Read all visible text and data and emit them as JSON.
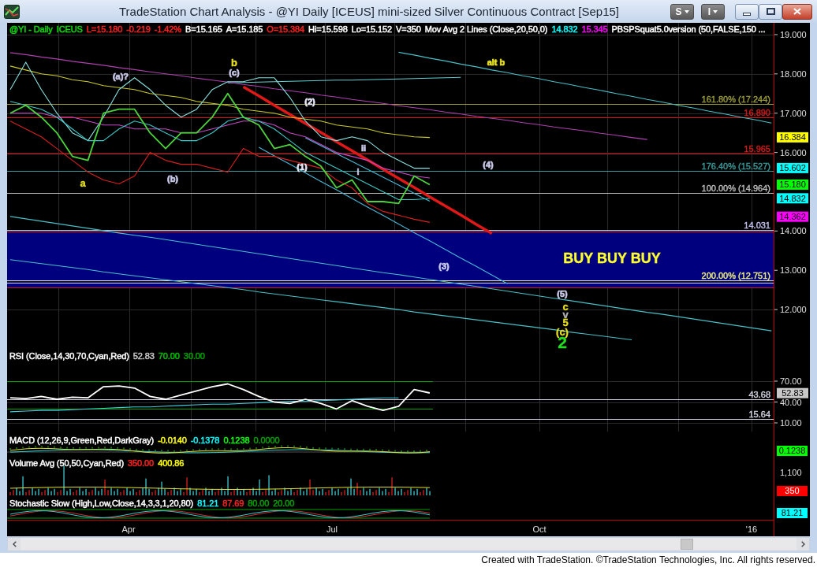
{
  "window": {
    "title": "TradeStation Chart Analysis - @YI Daily [ICEUS] mini-sized Silver Continuous Contract [Sep15]",
    "buttons": [
      {
        "label": "S"
      },
      {
        "label": "I"
      }
    ]
  },
  "price_panel": {
    "legend": [
      {
        "text": "@YI - Daily",
        "color": "#00e000"
      },
      {
        "text": "ICEUS",
        "color": "#00e000"
      },
      {
        "text": "L=15.180",
        "color": "#ff2020"
      },
      {
        "text": "-0.219",
        "color": "#ff2020"
      },
      {
        "text": "-1.42%",
        "color": "#ff2020"
      },
      {
        "text": "B=15.165",
        "color": "#ffffff"
      },
      {
        "text": "A=15.185",
        "color": "#ffffff"
      },
      {
        "text": "O=15.384",
        "color": "#ff2020"
      },
      {
        "text": "Hi=15.598",
        "color": "#ffffff"
      },
      {
        "text": "Lo=15.152",
        "color": "#ffffff"
      },
      {
        "text": "V=350",
        "color": "#ffffff"
      },
      {
        "text": "Mov Avg 2 Lines (Close,20,50,0)",
        "color": "#ffffff"
      },
      {
        "text": "14.832",
        "color": "#00ffff"
      },
      {
        "text": "15.345",
        "color": "#ff00ff"
      },
      {
        "text": "PBSPSquat5.0version (50,FALSE,150 ...",
        "color": "#ffffff"
      }
    ],
    "labels": [
      {
        "text": "b",
        "kind": "wave",
        "color": "#e8e020"
      },
      {
        "text": "(c)",
        "kind": "sub",
        "color": "#c8c8e8"
      },
      {
        "text": "(a)?",
        "kind": "sub",
        "color": "#c8c8e8"
      },
      {
        "text": "a",
        "kind": "wave",
        "color": "#e8e020"
      },
      {
        "text": "(b)",
        "kind": "sub",
        "color": "#c8c8e8"
      },
      {
        "text": "(2)",
        "kind": "sub",
        "color": "#e8e8f8"
      },
      {
        "text": "(1)",
        "kind": "sub",
        "color": "#e8e8f8"
      },
      {
        "text": "ii",
        "kind": "sub",
        "color": "#c8c8e8"
      },
      {
        "text": "i",
        "kind": "sub",
        "color": "#c8c8e8"
      },
      {
        "text": "(4)",
        "kind": "sub",
        "color": "#c8c8e8"
      },
      {
        "text": "alt b",
        "kind": "sub",
        "color": "#e8e020"
      },
      {
        "text": "(3)",
        "kind": "sub",
        "color": "#c8c8e8"
      },
      {
        "text": "BUY BUY BUY",
        "kind": "callout",
        "color": "#ffff30"
      },
      {
        "text": "(5)",
        "kind": "sub",
        "color": "#c8c8e8"
      },
      {
        "text": "c",
        "kind": "wave",
        "color": "#e8e020"
      },
      {
        "text": "v",
        "kind": "wave",
        "color": "#b4b4b4"
      },
      {
        "text": "5",
        "kind": "wave",
        "color": "#e8e020"
      },
      {
        "text": "(c)",
        "kind": "wave",
        "color": "#e8e020"
      },
      {
        "text": "2",
        "kind": "major",
        "color": "#22dd22"
      }
    ],
    "price_tags": [
      {
        "label": "16.384",
        "color": "#ffff00"
      },
      {
        "label": "15.602",
        "color": "#00ffff"
      },
      {
        "label": "15.180",
        "color": "#00ff00"
      },
      {
        "label": "14.832",
        "color": "#00ffff"
      },
      {
        "label": "14.362",
        "color": "#ff00ff"
      }
    ],
    "chart_data": {
      "type": "line",
      "grid": true,
      "categories": [
        null,
        null,
        null,
        null,
        null,
        null,
        null,
        null,
        null,
        null,
        null,
        null,
        null,
        null,
        null,
        null,
        null,
        null,
        null,
        null,
        null,
        null,
        null,
        null,
        null,
        null,
        null,
        null,
        null,
        null,
        null,
        null,
        null,
        null,
        null,
        null,
        null,
        null,
        null,
        null,
        null,
        null,
        null,
        null,
        null,
        null,
        null,
        null,
        null,
        null
      ],
      "series": [
        {
          "color": "#4cd43c",
          "values": [
            17.0,
            17.2,
            16.9,
            16.5,
            15.9,
            15.8,
            17.0,
            17.1,
            17.1,
            16.5,
            16.1,
            16.5,
            16.5,
            16.9,
            17.5,
            16.9,
            16.7,
            16.1,
            16.2,
            15.9,
            15.65,
            15.1,
            15.3,
            14.75,
            14.75,
            14.7,
            15.4,
            15.18,
            null,
            null,
            null,
            null,
            null,
            null,
            null,
            null,
            null,
            null,
            null,
            null,
            null,
            null,
            null,
            null,
            null,
            null,
            null,
            null,
            null,
            null
          ]
        },
        {
          "color": "#3cc8c8",
          "values": [
            17.3,
            17.2,
            17.1,
            16.9,
            16.6,
            16.3,
            16.3,
            16.6,
            16.8,
            16.7,
            16.5,
            16.3,
            16.3,
            16.5,
            16.8,
            16.9,
            16.8,
            16.6,
            16.3,
            16.0,
            15.8,
            15.6,
            15.4,
            15.2,
            15.0,
            14.8,
            14.8,
            14.83,
            null,
            null,
            null,
            null,
            null,
            null,
            null,
            null,
            null,
            null,
            null,
            null,
            null,
            null,
            null,
            null,
            null,
            null,
            null,
            null,
            null,
            null
          ]
        },
        {
          "color": "#c848c8",
          "values": [
            17.0,
            17.0,
            17.0,
            16.9,
            16.9,
            16.8,
            16.7,
            16.7,
            16.6,
            16.6,
            16.6,
            16.5,
            16.5,
            16.6,
            16.7,
            16.8,
            16.8,
            16.7,
            16.5,
            16.4,
            16.2,
            16.0,
            15.9,
            15.8,
            15.6,
            15.5,
            15.4,
            15.35,
            null,
            null,
            null,
            null,
            null,
            null,
            null,
            null,
            null,
            null,
            null,
            null,
            null,
            null,
            null,
            null,
            null,
            null,
            null,
            null,
            null,
            null
          ]
        },
        {
          "color": "#8ae0e0",
          "values": [
            17.6,
            18.3,
            17.6,
            17.0,
            16.5,
            16.3,
            16.9,
            17.6,
            17.9,
            17.6,
            17.2,
            16.9,
            17.1,
            17.6,
            17.8,
            17.8,
            17.9,
            17.9,
            17.4,
            16.8,
            16.4,
            16.3,
            16.4,
            16.3,
            16.0,
            15.8,
            15.6,
            15.6,
            null,
            null,
            null,
            null,
            null,
            null,
            null,
            null,
            null,
            null,
            null,
            null,
            null,
            null,
            null,
            null,
            null,
            null,
            null,
            null,
            null,
            null
          ]
        },
        {
          "color": "#d82020",
          "values": [
            16.8,
            16.6,
            16.4,
            16.1,
            15.8,
            15.5,
            15.3,
            15.2,
            15.4,
            16.0,
            15.8,
            15.7,
            15.7,
            15.6,
            15.5,
            16.1,
            15.9,
            15.9,
            15.8,
            15.7,
            15.6,
            15.3,
            15.1,
            14.7,
            14.5,
            14.4,
            14.3,
            14.22,
            null,
            null,
            null,
            null,
            null,
            null,
            null,
            null,
            null,
            null,
            null,
            null,
            null,
            null,
            null,
            null,
            null,
            null,
            null,
            null,
            null,
            null
          ]
        },
        {
          "color": "#cccc28",
          "values": [
            18.2,
            18.1,
            18.0,
            17.95,
            17.85,
            17.8,
            17.7,
            17.65,
            17.6,
            17.5,
            17.45,
            17.4,
            17.3,
            17.25,
            17.2,
            17.1,
            17.05,
            17.0,
            16.9,
            16.85,
            16.8,
            16.7,
            16.65,
            16.6,
            16.5,
            16.45,
            16.4,
            16.38,
            null,
            null,
            null,
            null,
            null,
            null,
            null,
            null,
            null,
            null,
            null,
            null,
            null,
            null,
            null,
            null,
            null,
            null,
            null,
            null,
            null,
            null
          ]
        },
        {
          "color": "#e01818",
          "values": [
            null,
            null,
            null,
            null,
            null,
            null,
            null,
            null,
            null,
            null,
            null,
            null,
            null,
            null,
            null,
            17.67,
            17.44,
            17.2,
            16.97,
            16.74,
            16.51,
            16.27,
            16.04,
            15.81,
            15.57,
            15.34,
            15.11,
            14.87,
            14.64,
            14.41,
            14.17,
            13.94,
            null,
            null,
            null,
            null,
            null,
            null,
            null,
            null,
            null,
            null,
            null,
            null,
            null,
            null,
            null,
            null,
            null,
            null
          ]
        },
        {
          "color": "#48b8d8",
          "values": [
            null,
            null,
            null,
            null,
            null,
            null,
            null,
            null,
            null,
            null,
            null,
            null,
            null,
            null,
            null,
            null,
            16.13,
            15.91,
            15.7,
            15.48,
            15.26,
            15.05,
            14.83,
            14.61,
            14.4,
            14.18,
            13.96,
            13.75,
            13.53,
            13.31,
            13.1,
            12.88,
            12.66,
            null,
            null,
            null,
            null,
            null,
            null,
            null,
            null,
            null,
            null,
            null,
            null,
            null,
            null,
            null,
            null,
            null
          ]
        },
        {
          "color": "#48b8d8",
          "values": [
            null,
            null,
            null,
            null,
            null,
            null,
            null,
            null,
            null,
            null,
            null,
            null,
            null,
            null,
            null,
            null,
            null,
            null,
            null,
            16.37,
            16.17,
            15.97,
            15.77,
            15.57,
            15.37,
            15.17,
            14.96,
            14.76,
            null,
            null,
            null,
            null,
            null,
            null,
            null,
            null,
            null,
            null,
            null,
            null,
            null,
            null,
            null,
            null,
            null,
            null,
            null,
            null,
            null,
            null
          ]
        },
        {
          "color": "#b040b0",
          "values": [
            18.54,
            18.49,
            18.43,
            18.38,
            18.32,
            18.27,
            18.22,
            18.16,
            18.11,
            18.05,
            18.0,
            17.95,
            17.89,
            17.84,
            17.79,
            17.73,
            17.68,
            17.62,
            17.57,
            17.52,
            17.46,
            17.41,
            17.35,
            17.3,
            17.25,
            17.19,
            17.14,
            17.09,
            17.03,
            16.98,
            16.92,
            16.87,
            16.82,
            16.76,
            16.71,
            16.65,
            16.6,
            16.55,
            16.49,
            16.44,
            16.38,
            16.33,
            null,
            null,
            null,
            null,
            null,
            null,
            null,
            null
          ]
        },
        {
          "color": "#48c0c8",
          "values": [
            null,
            null,
            null,
            null,
            null,
            null,
            null,
            null,
            null,
            null,
            null,
            null,
            null,
            null,
            null,
            null,
            null,
            null,
            null,
            null,
            null,
            null,
            null,
            null,
            null,
            18.55,
            18.48,
            18.4,
            18.33,
            18.25,
            18.18,
            18.1,
            18.03,
            17.95,
            17.88,
            17.8,
            17.73,
            17.65,
            17.58,
            17.5,
            17.43,
            17.35,
            17.28,
            17.2,
            17.13,
            17.05,
            16.98,
            16.9,
            16.83,
            16.75
          ]
        },
        {
          "color": "#60d0d0",
          "values": [
            null,
            null,
            null,
            null,
            null,
            null,
            null,
            null,
            null,
            null,
            null,
            null,
            null,
            null,
            17.77,
            17.78,
            17.79,
            17.8,
            17.81,
            17.82,
            17.83,
            17.84,
            17.84,
            17.85,
            17.86,
            17.87,
            17.88,
            17.89,
            17.9,
            17.91,
            null,
            null,
            null,
            null,
            null,
            null,
            null,
            null,
            null,
            null,
            null,
            null,
            null,
            null,
            null,
            null,
            null,
            null,
            null,
            null
          ]
        },
        {
          "color": "#48c0c8",
          "values": [
            14.37,
            14.31,
            14.25,
            14.19,
            14.13,
            14.07,
            14.01,
            13.95,
            13.89,
            13.84,
            13.78,
            13.72,
            13.66,
            13.6,
            13.54,
            13.48,
            13.42,
            13.36,
            13.3,
            13.24,
            13.18,
            13.12,
            13.06,
            13.0,
            12.94,
            12.89,
            12.83,
            12.77,
            12.71,
            12.65,
            12.59,
            12.53,
            12.47,
            12.41,
            12.35,
            12.29,
            12.23,
            12.17,
            12.11,
            12.05,
            11.99,
            11.93,
            11.88,
            11.82,
            11.76,
            11.7,
            11.64,
            11.58,
            11.52,
            11.46
          ]
        },
        {
          "color": "#48c0c8",
          "values": [
            13.27,
            13.22,
            13.17,
            13.12,
            13.07,
            13.02,
            12.96,
            12.91,
            12.86,
            12.81,
            12.76,
            12.71,
            12.66,
            12.61,
            12.56,
            12.51,
            12.45,
            12.4,
            12.35,
            12.3,
            12.25,
            12.2,
            12.15,
            12.1,
            12.05,
            12.0,
            11.94,
            11.89,
            11.84,
            11.79,
            11.74,
            11.69,
            11.64,
            11.59,
            11.54,
            11.49,
            11.43,
            11.38,
            11.33,
            11.28,
            11.23,
            null,
            null,
            null,
            null,
            null,
            null,
            null,
            null,
            null
          ]
        }
      ],
      "ylim": [
        11.0,
        19.3
      ],
      "yticks": [
        {
          "value": 12,
          "label": "12.000"
        },
        {
          "value": 13,
          "label": "13.000"
        },
        {
          "value": 14,
          "label": "14.000"
        },
        {
          "value": 16,
          "label": "16.000"
        },
        {
          "value": 17,
          "label": "17.000"
        },
        {
          "value": 18,
          "label": "18.000"
        },
        {
          "value": 19,
          "label": "19.000"
        }
      ],
      "ref_lines": [
        {
          "axis": "y",
          "value": 17.244,
          "label": "161.80% (17.244)",
          "color": "#9a9a3a"
        },
        {
          "axis": "y",
          "value": 16.89,
          "label": "16.890",
          "color": "#d81818"
        },
        {
          "axis": "y",
          "value": 15.965,
          "label": "15.965",
          "color": "#d81818"
        },
        {
          "axis": "y",
          "value": 15.527,
          "label": "176.40% (15.527)",
          "color": "#3a9a9a"
        },
        {
          "axis": "y",
          "value": 14.964,
          "label": "100.00% (14.964)",
          "color": "#bcbcbc"
        },
        {
          "axis": "y",
          "value": 14.031,
          "label": "14.031",
          "color": "#c0c0ee"
        },
        {
          "axis": "y",
          "value": 13.98,
          "color": "#c81818"
        },
        {
          "axis": "y",
          "value": 12.751,
          "label": "200.00% (12.751)",
          "color": "#eeee80"
        },
        {
          "axis": "y",
          "value": 12.678,
          "color": "#d8d8f8"
        },
        {
          "axis": "y",
          "value": 12.57,
          "color": "#c81818"
        }
      ],
      "bands": [
        {
          "axis": "y",
          "from": 12.57,
          "to": 13.98,
          "color": "#00007e"
        }
      ]
    }
  },
  "rsi_panel": {
    "legend": [
      {
        "text": "RSI (Close,14,30,70,Cyan,Red)",
        "color": "#ffffff"
      },
      {
        "text": "52.83",
        "color": "#c8c8c8"
      },
      {
        "text": "70.00",
        "color": "#00c000"
      },
      {
        "text": "30.00",
        "color": "#00a000"
      }
    ],
    "tag": {
      "label": "52.83",
      "color": "#c8c8c8"
    },
    "chart_data": {
      "type": "line",
      "grid": true,
      "categories": [
        null,
        null,
        null,
        null,
        null,
        null,
        null,
        null,
        null,
        null,
        null,
        null,
        null,
        null,
        null,
        null,
        null,
        null,
        null,
        null,
        null,
        null,
        null,
        null,
        null,
        null,
        null,
        null
      ],
      "series": [
        {
          "color": "#ffffff",
          "values": [
            46,
            45,
            48,
            44,
            47,
            46,
            62,
            63,
            60,
            48,
            44,
            50,
            56,
            62,
            66,
            58,
            48,
            40,
            38,
            44,
            38,
            30,
            42,
            34,
            28,
            34,
            58,
            53
          ]
        },
        {
          "color": "#40d0e0",
          "values": [
            26,
            27,
            28,
            28,
            29,
            30,
            31,
            32,
            33,
            33,
            34,
            35,
            36,
            37,
            37,
            38,
            39,
            40,
            41,
            41,
            42,
            43,
            44,
            45,
            46,
            46,
            null,
            null
          ]
        }
      ],
      "ylim": [
        -2.45,
        116.42
      ],
      "yticks": [
        {
          "value": 70,
          "label": "70.00"
        },
        {
          "value": 40,
          "label": "40.00"
        },
        {
          "value": 10,
          "label": "10.00"
        }
      ],
      "ref_lines": [
        {
          "axis": "y",
          "value": 70,
          "color": "#00a000"
        },
        {
          "axis": "y",
          "value": 43.68,
          "label": "43.68",
          "color": "#d0d0e0"
        },
        {
          "axis": "y",
          "value": 30,
          "color": "#00a000"
        },
        {
          "axis": "y",
          "value": 15.64,
          "label": "15.64",
          "color": "#d0d0e0"
        }
      ]
    }
  },
  "macd_panel": {
    "legend": [
      {
        "text": "MACD (12,26,9,Green,Red,DarkGray)",
        "color": "#ffffff"
      },
      {
        "text": "-0.0140",
        "color": "#ffff00"
      },
      {
        "text": "-0.1378",
        "color": "#00ffff"
      },
      {
        "text": "0.1238",
        "color": "#00ff00"
      },
      {
        "text": "0.0000",
        "color": "#00a000"
      }
    ],
    "tag": {
      "label": "0.1238",
      "color": "#00ff00"
    }
  },
  "volume_panel": {
    "legend": [
      {
        "text": "Volume Avg (50,50,Cyan,Red)",
        "color": "#ffffff"
      },
      {
        "text": "350.00",
        "color": "#ff2020"
      },
      {
        "text": "400.86",
        "color": "#ffff00"
      }
    ],
    "axis_labels": [
      "1,100"
    ],
    "tag": {
      "label": "350",
      "color": "#ff0000"
    }
  },
  "stochastic_panel": {
    "legend": [
      {
        "text": "Stochastic Slow (High,Low,Close,14,3,3,1,20,80)",
        "color": "#ffffff"
      },
      {
        "text": "81.21",
        "color": "#00ffff"
      },
      {
        "text": "87.69",
        "color": "#ff2020"
      },
      {
        "text": "80.00",
        "color": "#00a000"
      },
      {
        "text": "20.00",
        "color": "#00a000"
      }
    ],
    "tag": {
      "label": "81.21",
      "color": "#00ffff"
    }
  },
  "time_axis": {
    "labels": [
      "Apr",
      "Jul",
      "Oct",
      "'16"
    ]
  },
  "footer": {
    "text": "Created with TradeStation. ©TradeStation Technologies, Inc. All rights reserved."
  }
}
